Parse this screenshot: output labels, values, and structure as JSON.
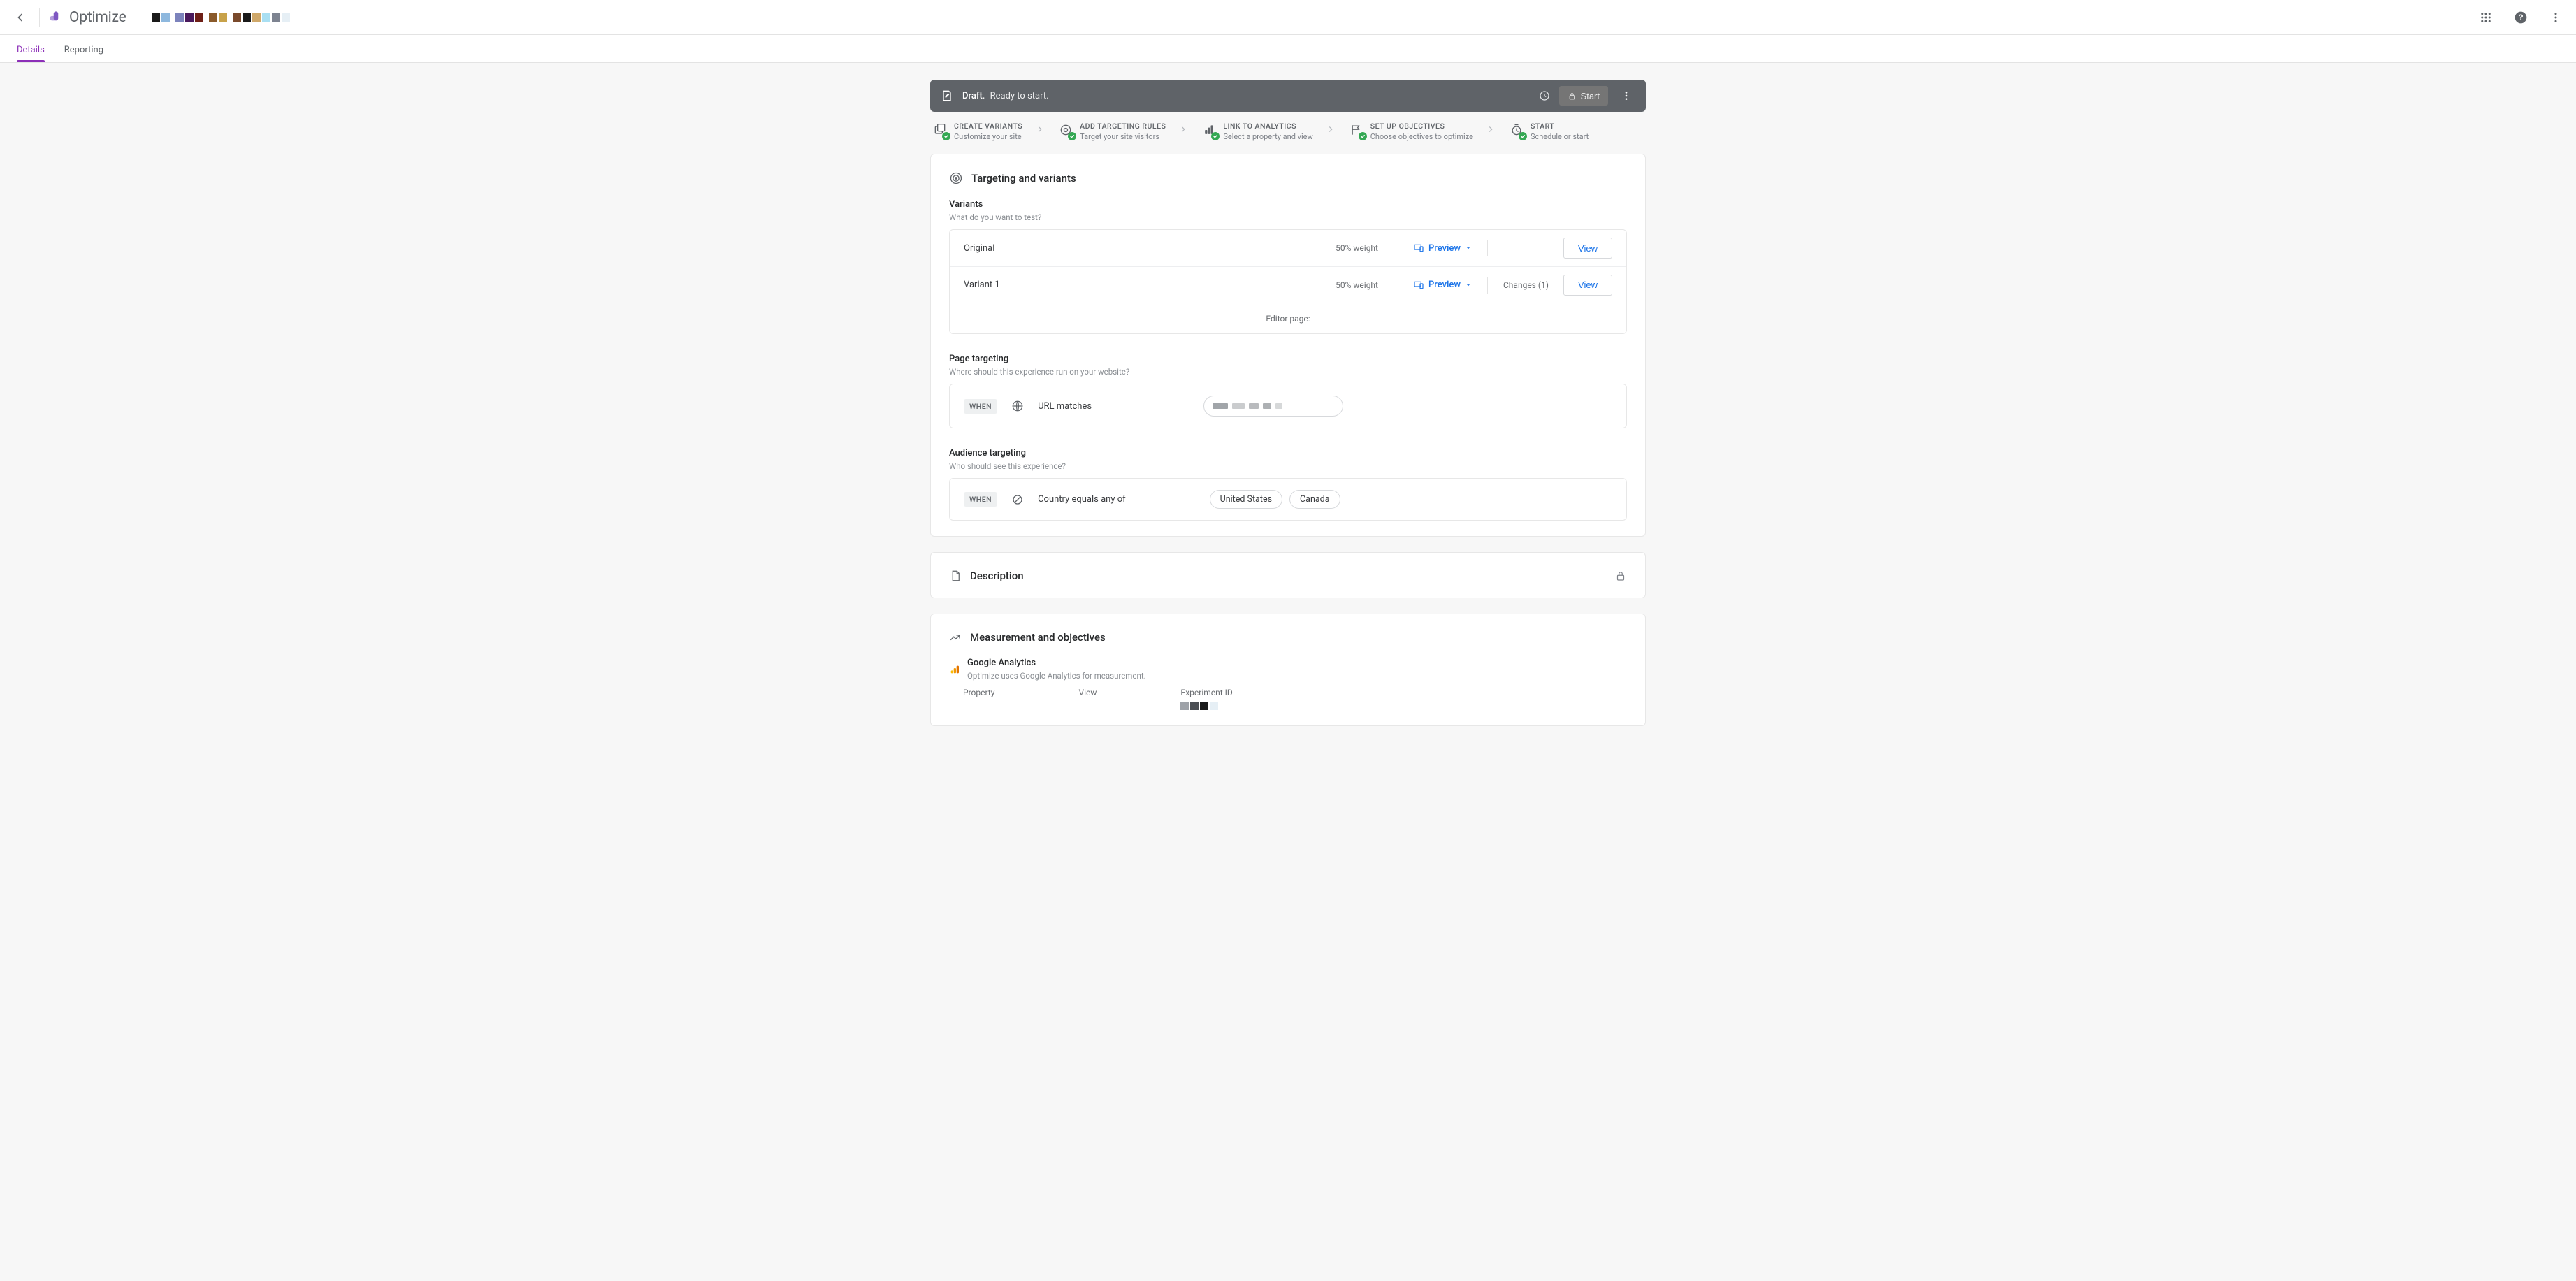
{
  "app": {
    "name": "Optimize",
    "tabs": [
      "Details",
      "Reporting"
    ],
    "activeTab": 0
  },
  "status": {
    "name": "Draft.",
    "ready": "Ready to start.",
    "startLabel": "Start"
  },
  "stepper": [
    {
      "title": "CREATE VARIANTS",
      "sub": "Customize your site"
    },
    {
      "title": "ADD TARGETING RULES",
      "sub": "Target your site visitors"
    },
    {
      "title": "LINK TO ANALYTICS",
      "sub": "Select a property and view"
    },
    {
      "title": "SET UP OBJECTIVES",
      "sub": "Choose objectives to optimize"
    },
    {
      "title": "START",
      "sub": "Schedule or start"
    }
  ],
  "targeting": {
    "heading": "Targeting and variants",
    "variants": {
      "label": "Variants",
      "hint": "What do you want to test?",
      "rows": [
        {
          "name": "Original",
          "weight": "50% weight",
          "changes": ""
        },
        {
          "name": "Variant 1",
          "weight": "50% weight",
          "changes": "Changes (1)"
        }
      ],
      "previewLabel": "Preview",
      "viewLabel": "View",
      "editorLabel": "Editor page:"
    },
    "page": {
      "label": "Page targeting",
      "hint": "Where should this experience run on your website?",
      "when": "WHEN",
      "rule": "URL matches"
    },
    "audience": {
      "label": "Audience targeting",
      "hint": "Who should see this experience?",
      "when": "WHEN",
      "rule": "Country equals any of",
      "values": [
        "United States",
        "Canada"
      ]
    }
  },
  "description": {
    "heading": "Description"
  },
  "measurement": {
    "heading": "Measurement and objectives",
    "gaTitle": "Google Analytics",
    "gaHint": "Optimize uses Google Analytics for measurement.",
    "cols": {
      "property": "Property",
      "view": "View",
      "experimentId": "Experiment ID"
    }
  },
  "header_swatches": [
    [
      "#1a1a1a",
      "#8eb8de"
    ],
    [
      "#7c83bc",
      "#4a195c",
      "#6e1f17"
    ],
    [
      "#8a5a2b",
      "#c8a24a"
    ],
    [
      "#7a4a2c",
      "#1a1a1a",
      "#cfa86a",
      "#a9dff2",
      "#7d8390",
      "#e6eff5"
    ]
  ],
  "exp_swatches": [
    "#9ea2a8",
    "#4b4f54",
    "#1a1a1a",
    "#e6eff5"
  ]
}
